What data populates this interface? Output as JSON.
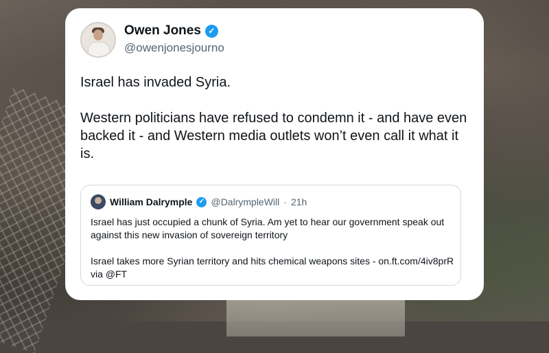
{
  "tweet": {
    "author_name": "Owen Jones",
    "author_handle": "@owenjonesjourno",
    "verified_mark": "✓",
    "text": "Israel has invaded Syria.\n\nWestern politicians have refused to condemn it - and have even backed it - and Western media outlets won’t even call it what it is."
  },
  "quoted_tweet": {
    "author_name": "William Dalrymple",
    "author_handle": "@DalrympleWill",
    "separator": "·",
    "time": "21h",
    "verified_mark": "✓",
    "text": "Israel has just occupied a chunk of Syria. Am yet to hear our government speak out against this new invasion of sovereign territory\n\nIsrael takes more Syrian territory and hits chemical weapons sites - on.ft.com/4iv8prR via @FT"
  },
  "colors": {
    "verified_blue": "#1d9bf0",
    "text_primary": "#0f1419",
    "text_secondary": "#536471"
  }
}
